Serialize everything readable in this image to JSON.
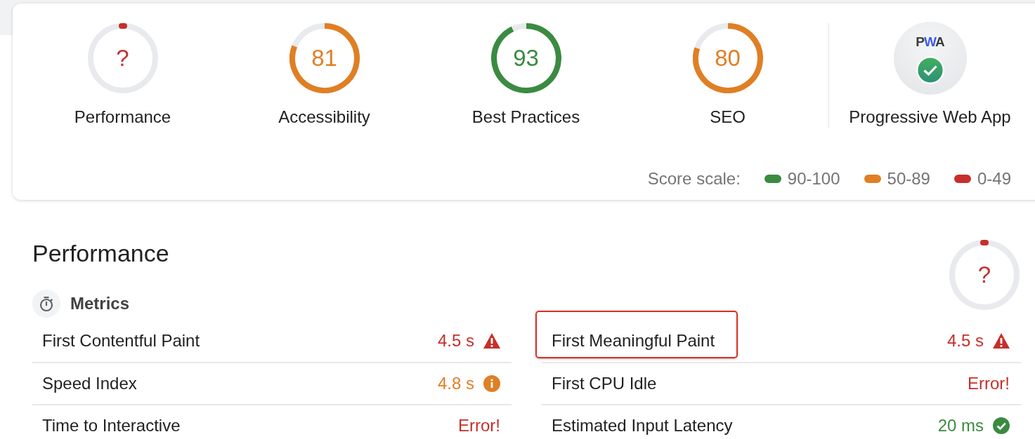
{
  "gauges": [
    {
      "label": "Performance",
      "score": "?",
      "color": "#c62f2b"
    },
    {
      "label": "Accessibility",
      "score": "81",
      "color": "#e07f24"
    },
    {
      "label": "Best Practices",
      "score": "93",
      "color": "#3a8b41"
    },
    {
      "label": "SEO",
      "score": "80",
      "color": "#e07f24"
    }
  ],
  "pwa": {
    "label": "Progressive Web App",
    "badge_text": "PWA"
  },
  "score_scale": {
    "label": "Score scale:",
    "ranges": [
      {
        "label": "90-100",
        "color": "#3a8b41"
      },
      {
        "label": "50-89",
        "color": "#e07f24"
      },
      {
        "label": "0-49",
        "color": "#c62f2b"
      }
    ]
  },
  "performance": {
    "title": "Performance",
    "gauge": {
      "score": "?",
      "color": "#c62f2b"
    },
    "metrics_title": "Metrics",
    "metrics": [
      {
        "label": "First Contentful Paint",
        "value": "4.5 s",
        "kind": "warning",
        "color": "#c62f2b",
        "highlighted": false
      },
      {
        "label": "First Meaningful Paint",
        "value": "4.5 s",
        "kind": "warning",
        "color": "#c62f2b",
        "highlighted": true
      },
      {
        "label": "Speed Index",
        "value": "4.8 s",
        "kind": "info",
        "color": "#e07f24",
        "highlighted": false
      },
      {
        "label": "First CPU Idle",
        "value": "Error!",
        "kind": "plain",
        "color": "#c62f2b",
        "highlighted": false
      },
      {
        "label": "Time to Interactive",
        "value": "Error!",
        "kind": "plain",
        "color": "#c62f2b",
        "highlighted": false
      },
      {
        "label": "Estimated Input Latency",
        "value": "20 ms",
        "kind": "check",
        "color": "#3a8b41",
        "highlighted": false
      }
    ]
  }
}
